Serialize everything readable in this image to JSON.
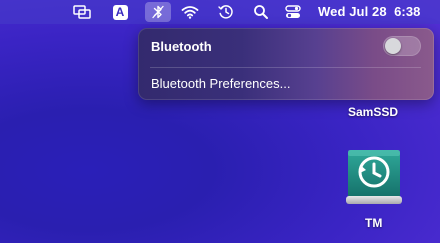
{
  "menubar": {
    "clock": "Wed Jul 28  6:38",
    "input_source_label": "A",
    "icons": [
      "display-mirror-icon",
      "input-source-icon",
      "bluetooth-icon",
      "wifi-icon",
      "time-machine-icon",
      "search-icon",
      "control-center-icon"
    ]
  },
  "bluetooth_menu": {
    "title": "Bluetooth",
    "toggle_state": "off",
    "preferences_label": "Bluetooth Preferences..."
  },
  "desktop": {
    "items": [
      {
        "label": "SamSSD"
      },
      {
        "label": "TM"
      }
    ]
  }
}
